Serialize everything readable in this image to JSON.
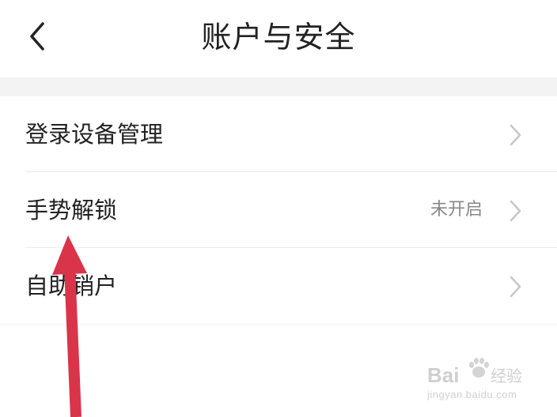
{
  "header": {
    "title": "账户与安全",
    "back_icon": "chevron-left-icon"
  },
  "settings": {
    "items": [
      {
        "label": "登录设备管理",
        "value": "",
        "icon": "chevron-right-icon"
      },
      {
        "label": "手势解锁",
        "value": "未开启",
        "icon": "chevron-right-icon"
      },
      {
        "label": "自助销户",
        "value": "",
        "icon": "chevron-right-icon"
      }
    ]
  },
  "annotation": {
    "arrow_color": "#d9344a"
  },
  "watermark": {
    "brand": "Bai",
    "brand_cn": "经验",
    "url": "jingyan.baidu.com"
  },
  "colors": {
    "background": "#ffffff",
    "section_gap": "#f3f3f3",
    "text_primary": "#222222",
    "text_secondary": "#888888",
    "chevron": "#c7c7c7"
  }
}
